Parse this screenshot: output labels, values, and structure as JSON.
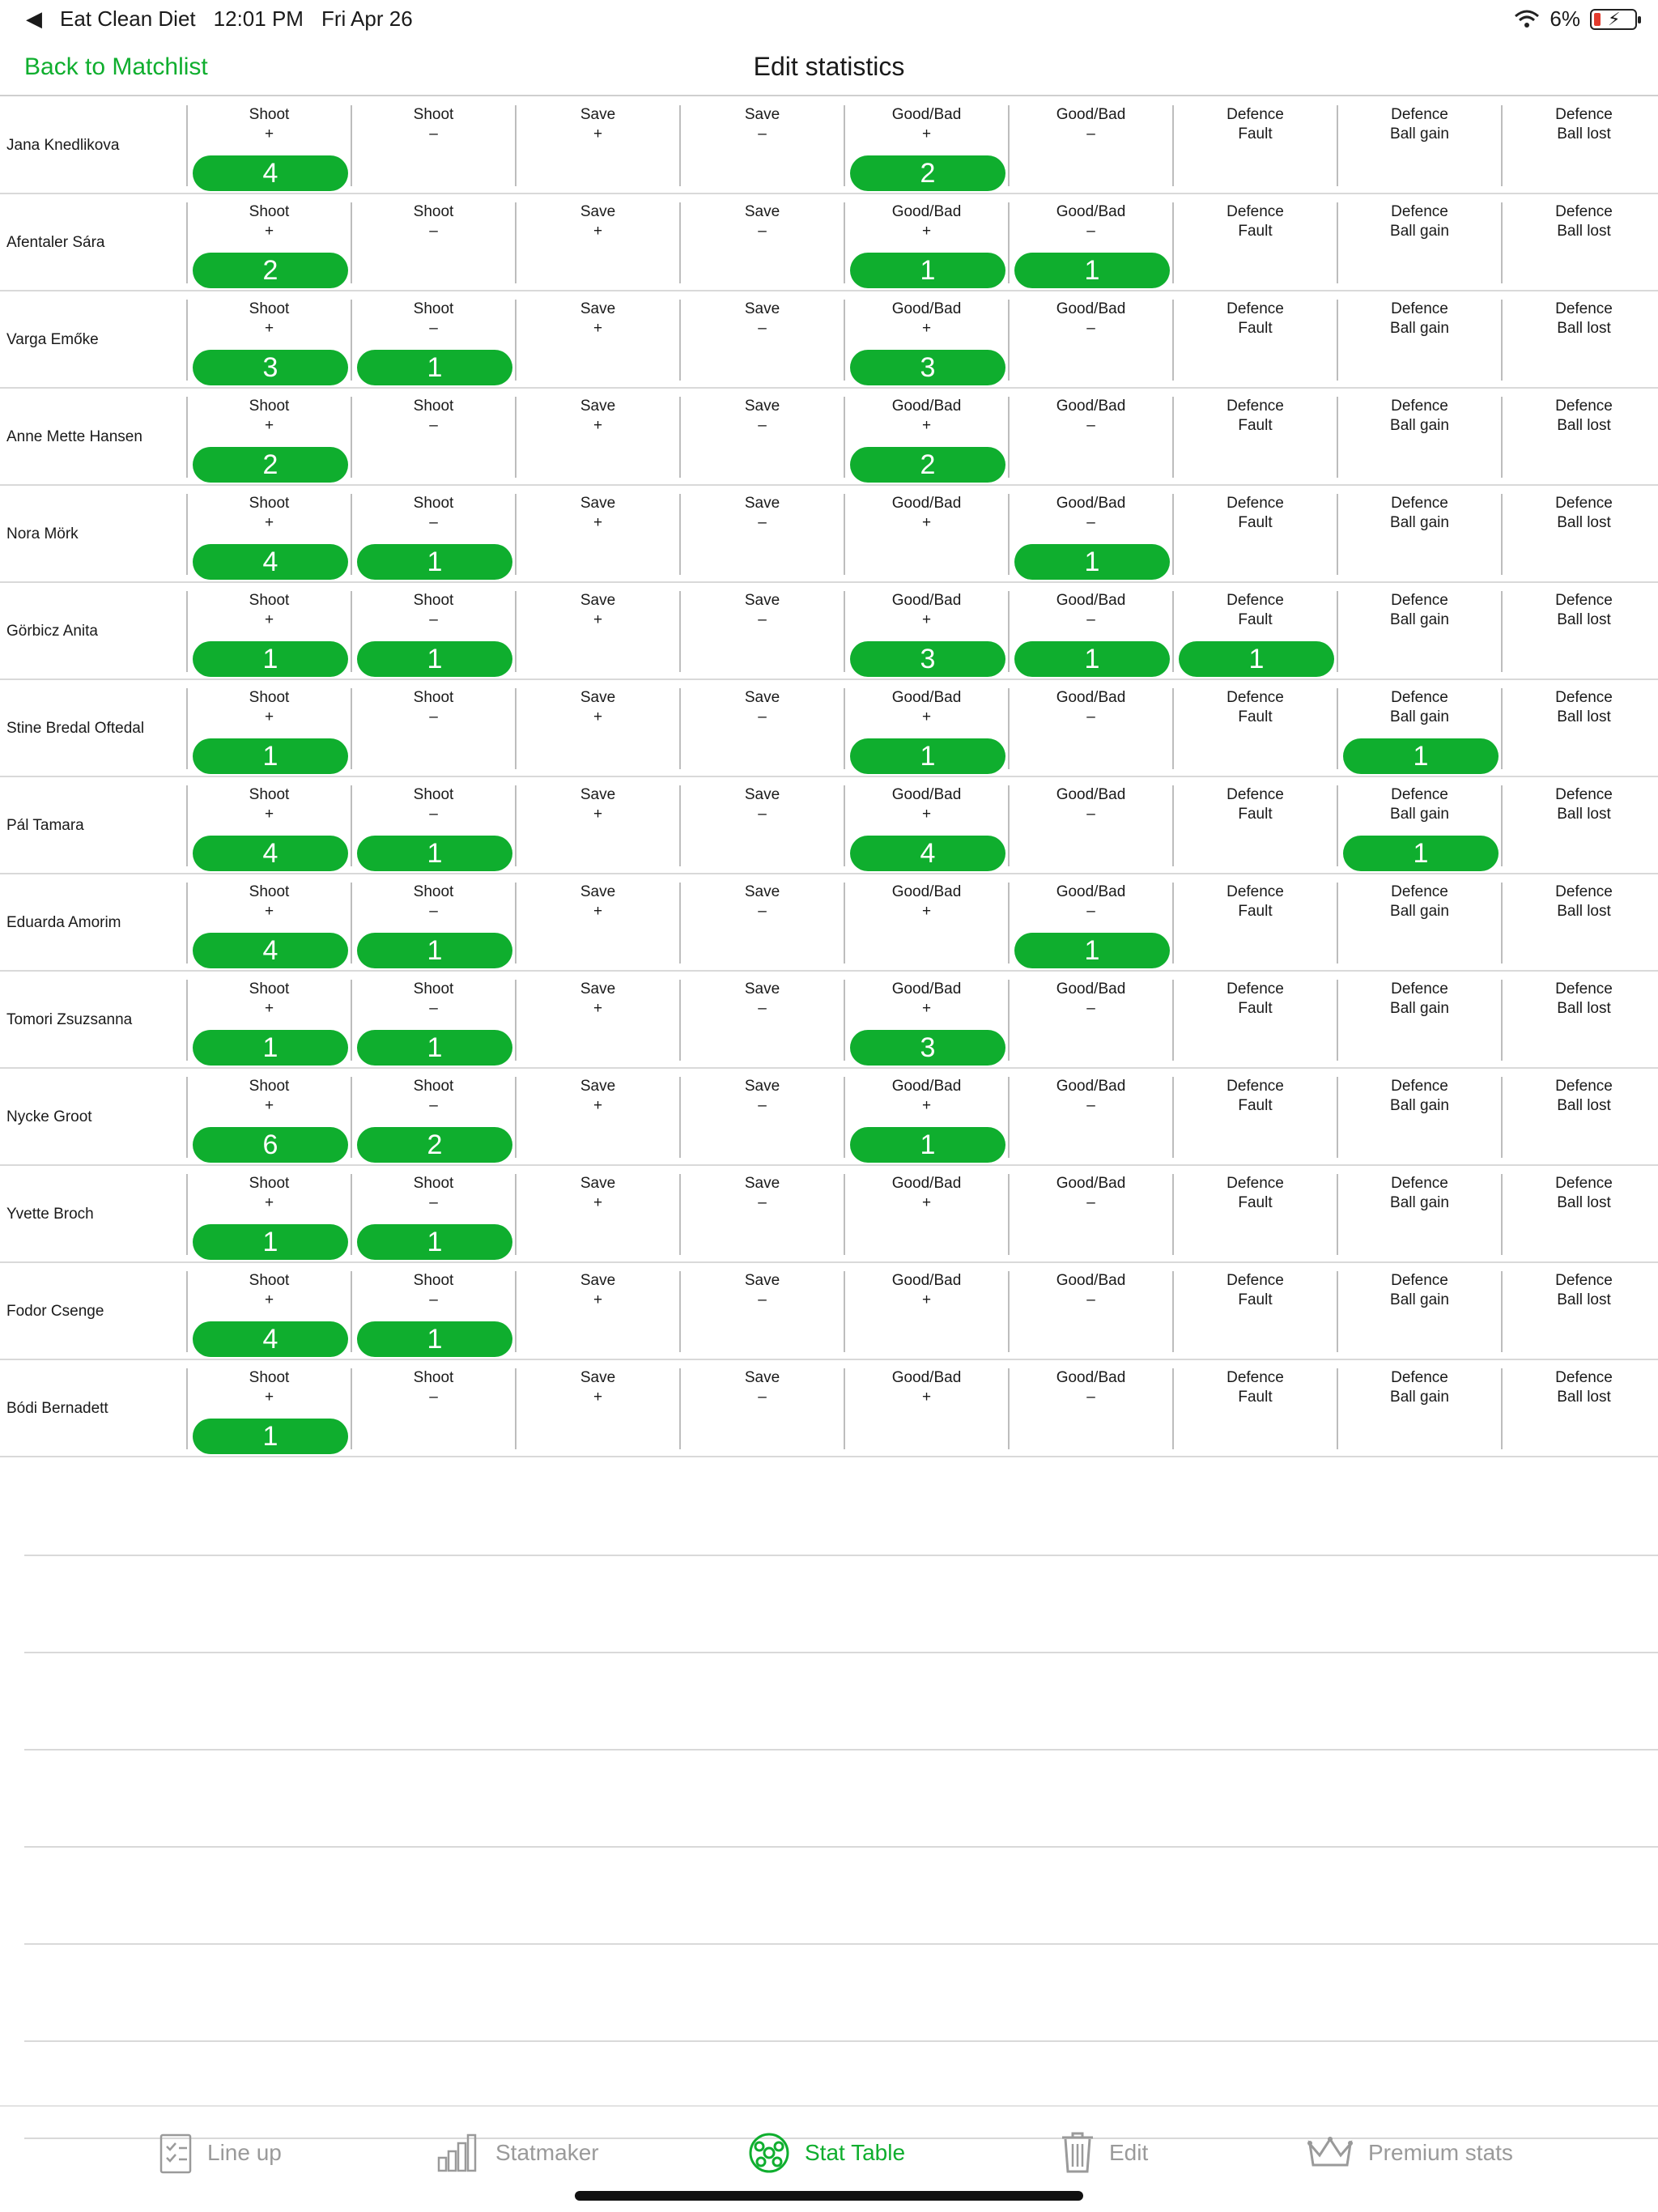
{
  "status_bar": {
    "back_app": "Eat Clean Diet",
    "time": "12:01 PM",
    "date": "Fri Apr 26",
    "battery": "6%"
  },
  "nav": {
    "back_label": "Back to Matchlist",
    "title": "Edit statistics"
  },
  "columns": [
    {
      "line1": "Shoot",
      "line2": "+"
    },
    {
      "line1": "Shoot",
      "line2": "–"
    },
    {
      "line1": "Save",
      "line2": "+"
    },
    {
      "line1": "Save",
      "line2": "–"
    },
    {
      "line1": "Good/Bad",
      "line2": "+"
    },
    {
      "line1": "Good/Bad",
      "line2": "–"
    },
    {
      "line1": "Defence",
      "line2": "Fault"
    },
    {
      "line1": "Defence",
      "line2": "Ball gain"
    },
    {
      "line1": "Defence",
      "line2": "Ball lost"
    }
  ],
  "players": [
    {
      "name": "Jana Knedlikova",
      "values": [
        "4",
        null,
        null,
        null,
        "2",
        null,
        null,
        null,
        null
      ]
    },
    {
      "name": "Afentaler Sára",
      "values": [
        "2",
        null,
        null,
        null,
        "1",
        "1",
        null,
        null,
        null
      ]
    },
    {
      "name": "Varga Emőke",
      "values": [
        "3",
        "1",
        null,
        null,
        "3",
        null,
        null,
        null,
        null
      ]
    },
    {
      "name": "Anne Mette Hansen",
      "values": [
        "2",
        null,
        null,
        null,
        "2",
        null,
        null,
        null,
        null
      ]
    },
    {
      "name": "Nora Mörk",
      "values": [
        "4",
        "1",
        null,
        null,
        null,
        "1",
        null,
        null,
        null
      ]
    },
    {
      "name": "Görbicz Anita",
      "values": [
        "1",
        "1",
        null,
        null,
        "3",
        "1",
        "1",
        null,
        null
      ]
    },
    {
      "name": "Stine Bredal Oftedal",
      "values": [
        "1",
        null,
        null,
        null,
        "1",
        null,
        null,
        "1",
        null
      ]
    },
    {
      "name": "Pál Tamara",
      "values": [
        "4",
        "1",
        null,
        null,
        "4",
        null,
        null,
        "1",
        null
      ]
    },
    {
      "name": "Eduarda Amorim",
      "values": [
        "4",
        "1",
        null,
        null,
        null,
        "1",
        null,
        null,
        null
      ]
    },
    {
      "name": "Tomori Zsuzsanna",
      "values": [
        "1",
        "1",
        null,
        null,
        "3",
        null,
        null,
        null,
        null
      ]
    },
    {
      "name": "Nycke Groot",
      "values": [
        "6",
        "2",
        null,
        null,
        "1",
        null,
        null,
        null,
        null
      ]
    },
    {
      "name": "Yvette Broch",
      "values": [
        "1",
        "1",
        null,
        null,
        null,
        null,
        null,
        null,
        null
      ]
    },
    {
      "name": "Fodor Csenge",
      "values": [
        "4",
        "1",
        null,
        null,
        null,
        null,
        null,
        null,
        null
      ]
    },
    {
      "name": "Bódi Bernadett",
      "values": [
        "1",
        null,
        null,
        null,
        null,
        null,
        null,
        null,
        null
      ]
    }
  ],
  "tabs": [
    {
      "label": "Line up",
      "icon": "clipboard-checklist-icon",
      "active": false
    },
    {
      "label": "Statmaker",
      "icon": "bar-chart-icon",
      "active": false
    },
    {
      "label": "Stat Table",
      "icon": "ball-icon",
      "active": true
    },
    {
      "label": "Edit",
      "icon": "trash-icon",
      "active": false
    },
    {
      "label": "Premium stats",
      "icon": "crown-icon",
      "active": false
    }
  ],
  "colors": {
    "accent": "#0fae2e"
  }
}
